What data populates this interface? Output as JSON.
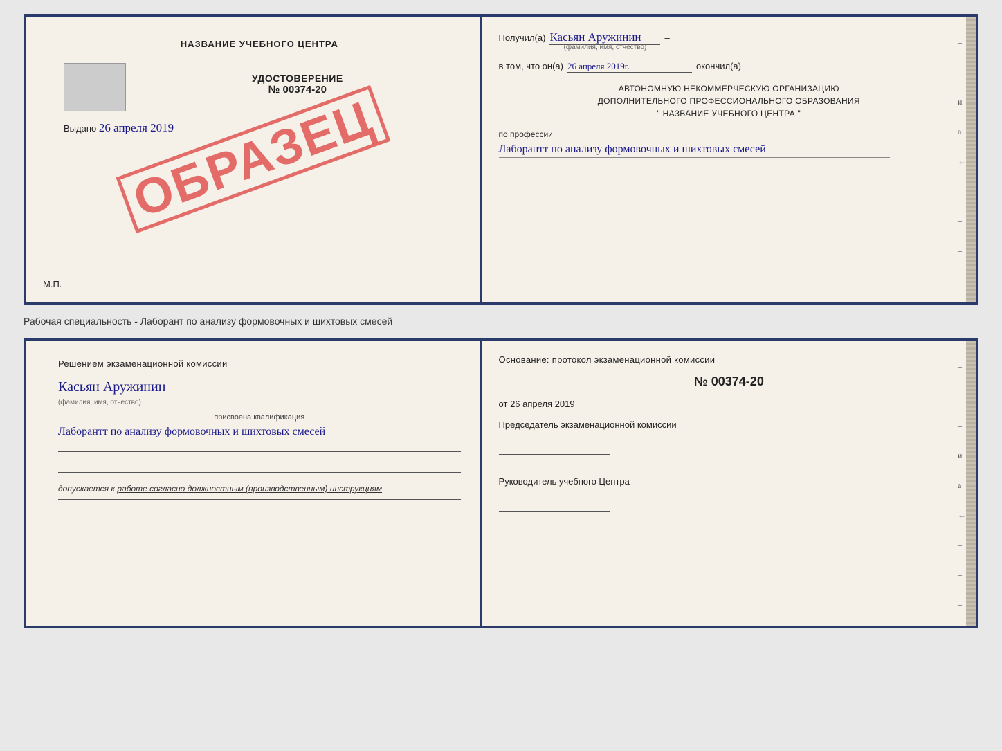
{
  "page": {
    "background": "#e8e8e8"
  },
  "top_cert": {
    "left": {
      "title": "НАЗВАНИЕ УЧЕБНОГО ЦЕНТРА",
      "udostoverenie_label": "УДОСТОВЕРЕНИЕ",
      "number": "№ 00374-20",
      "vydano_label": "Выдано",
      "vydano_date": "26 апреля 2019",
      "mp_label": "М.П.",
      "obrazets": "ОБРАЗЕЦ"
    },
    "right": {
      "poluchil_label": "Получил(a)",
      "poluchil_name": "Касьян Аружинин",
      "fio_label": "(фамилия, имя, отчество)",
      "vtom_label": "в том, что он(а)",
      "vtom_date": "26 апреля 2019г.",
      "okончил_label": "окончил(а)",
      "org_line1": "АВТОНОМНУЮ НЕКОММЕРЧЕСКУЮ ОРГАНИЗАЦИЮ",
      "org_line2": "ДОПОЛНИТЕЛЬНОГО ПРОФЕССИОНАЛЬНОГО ОБРАЗОВАНИЯ",
      "org_line3": "\"    НАЗВАНИЕ УЧЕБНОГО ЦЕНТРА    \"",
      "profession_label": "по профессии",
      "profession_text": "Лаборантт по анализу формовочных и шихтовых смесей"
    }
  },
  "separator": {
    "text": "Рабочая специальность - Лаборант по анализу формовочных и шихтовых смесей"
  },
  "bottom_cert": {
    "left": {
      "title": "Решением экзаменационной комиссии",
      "name_handwritten": "Касьян Аружинин",
      "fio_label": "(фамилия, имя, отчество)",
      "assigned_label": "присвоена квалификация",
      "profession_handwritten": "Лаборантт по анализу формовочных и шихтовых смесей",
      "допускается_label": "допускается к",
      "допускается_text": "работе согласно должностным (производственным) инструкциям"
    },
    "right": {
      "osnovanie_label": "Основание: протокол экзаменационной комиссии",
      "number_label": "№ 00374-20",
      "ot_label": "от",
      "ot_date": "26 апреля 2019",
      "chairman_label": "Председатель экзаменационной комиссии",
      "rukovoditel_label": "Руководитель учебного Центра"
    }
  }
}
